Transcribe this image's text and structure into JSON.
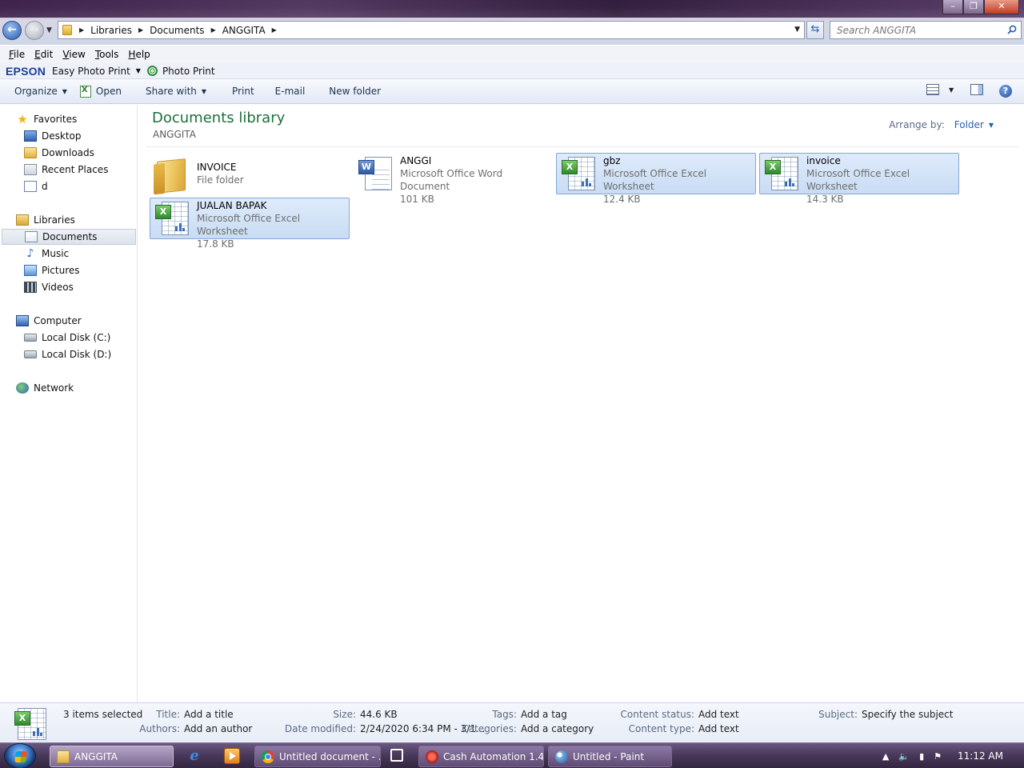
{
  "window": {
    "minimize_glyph": "–",
    "restore_glyph": "❐",
    "close_glyph": "✕"
  },
  "address": {
    "breadcrumbs": [
      "Libraries",
      "Documents",
      "ANGGITA"
    ],
    "search_placeholder": "Search ANGGITA"
  },
  "menubar": {
    "items": [
      {
        "accel": "F",
        "rest": "ile"
      },
      {
        "accel": "E",
        "rest": "dit"
      },
      {
        "accel": "V",
        "rest": "iew"
      },
      {
        "accel": "T",
        "rest": "ools"
      },
      {
        "accel": "H",
        "rest": "elp"
      }
    ]
  },
  "epson": {
    "logo": "EPSON",
    "easy_photo_print": "Easy Photo Print",
    "photo_print": "Photo Print"
  },
  "commandbar": {
    "organize": "Organize",
    "open": "Open",
    "share_with": "Share with",
    "print": "Print",
    "email": "E-mail",
    "new_folder": "New folder",
    "help_glyph": "?"
  },
  "navpane": {
    "favorites": "Favorites",
    "desktop": "Desktop",
    "downloads": "Downloads",
    "recent_places": "Recent Places",
    "d": "d",
    "libraries": "Libraries",
    "documents": "Documents",
    "music": "Music",
    "pictures": "Pictures",
    "videos": "Videos",
    "computer": "Computer",
    "local_disk_c": "Local Disk (C:)",
    "local_disk_d": "Local Disk (D:)",
    "network": "Network"
  },
  "content": {
    "title": "Documents library",
    "subtitle": "ANGGITA",
    "arrange_label": "Arrange by:",
    "arrange_value": "Folder",
    "items": [
      {
        "name": "INVOICE",
        "type": "File folder",
        "size": ""
      },
      {
        "name": "ANGGI",
        "type": "Microsoft Office Word Document",
        "size": "101 KB"
      },
      {
        "name": "gbz",
        "type": "Microsoft Office Excel Worksheet",
        "size": "12.4 KB"
      },
      {
        "name": "invoice",
        "type": "Microsoft Office Excel Worksheet",
        "size": "14.3 KB"
      },
      {
        "name": "JUALAN BAPAK",
        "type": "Microsoft Office Excel Worksheet",
        "size": "17.8 KB"
      }
    ]
  },
  "details": {
    "selection": "3 items selected",
    "title_label": "Title:",
    "title_value": "Add a title",
    "authors_label": "Authors:",
    "authors_value": "Add an author",
    "size_label": "Size:",
    "size_value": "44.6 KB",
    "date_label": "Date modified:",
    "date_value": "2/24/2020 6:34 PM - 3/1...",
    "tags_label": "Tags:",
    "tags_value": "Add a tag",
    "categories_label": "Categories:",
    "categories_value": "Add a category",
    "content_status_label": "Content status:",
    "content_status_value": "Add text",
    "content_type_label": "Content type:",
    "content_type_value": "Add text",
    "subject_label": "Subject:",
    "subject_value": "Specify the subject"
  },
  "taskbar": {
    "tasks": [
      "ANGGITA",
      "Untitled document - ...",
      "Cash Automation 1.4....",
      "Untitled - Paint"
    ],
    "clock": "11:12 AM"
  }
}
